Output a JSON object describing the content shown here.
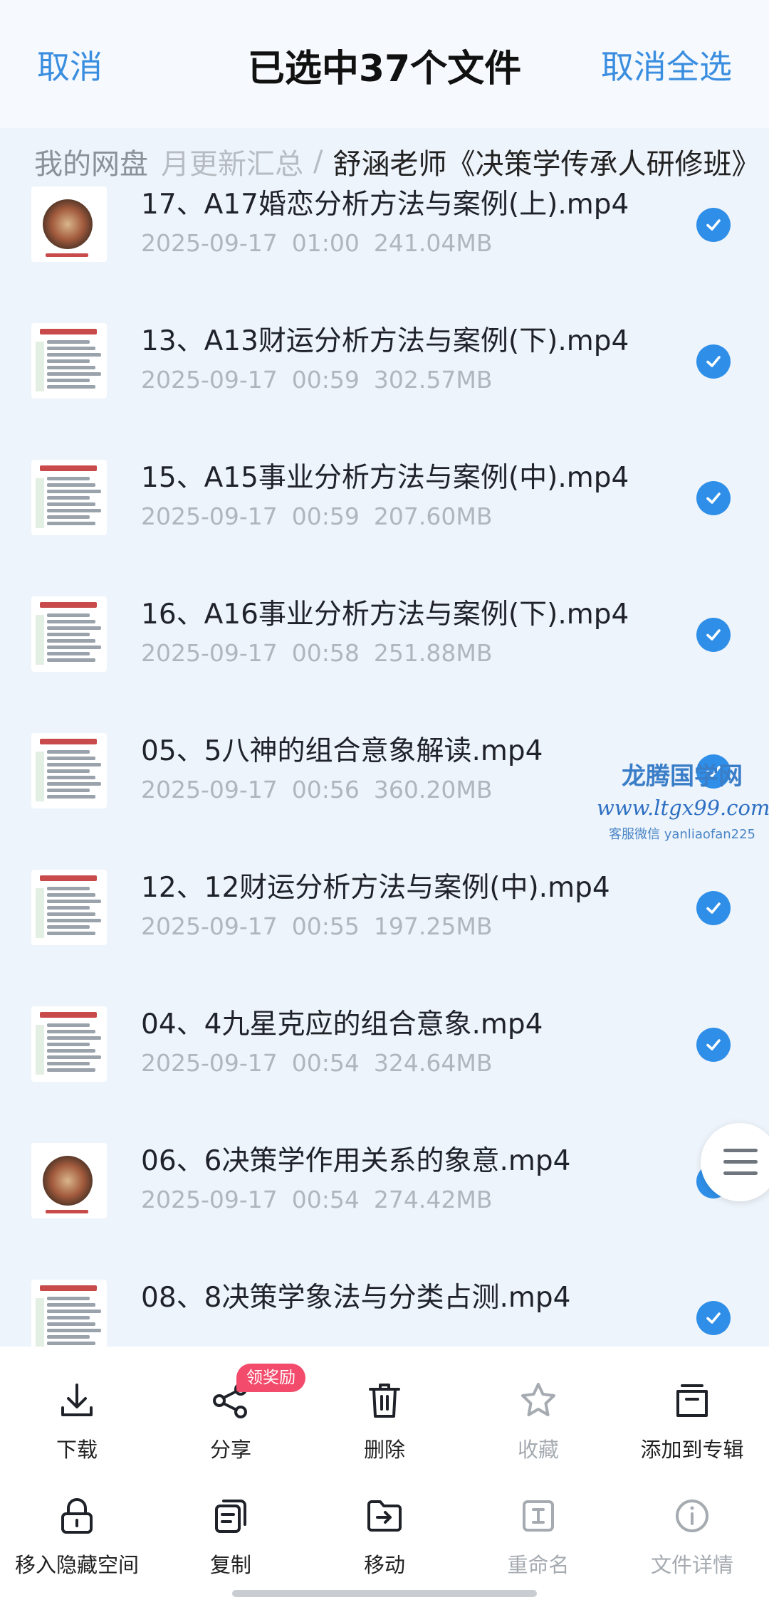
{
  "header": {
    "cancel": "取消",
    "title": "已选中37个文件",
    "deselect_all": "取消全选"
  },
  "breadcrumb": {
    "root": "我的网盘",
    "middle": "月更新汇总",
    "separator": "/",
    "current": "舒涵老师《决策学传承人研修班》"
  },
  "files": [
    {
      "name": "17、A17婚恋分析方法与案例(上).mp4",
      "date": "2025-09-17",
      "time": "01:00",
      "size": "241.04MB",
      "selected": true,
      "thumb": "chart"
    },
    {
      "name": "13、A13财运分析方法与案例(下).mp4",
      "date": "2025-09-17",
      "time": "00:59",
      "size": "302.57MB",
      "selected": true,
      "thumb": "doc"
    },
    {
      "name": "15、A15事业分析方法与案例(中).mp4",
      "date": "2025-09-17",
      "time": "00:59",
      "size": "207.60MB",
      "selected": true,
      "thumb": "doc"
    },
    {
      "name": "16、A16事业分析方法与案例(下).mp4",
      "date": "2025-09-17",
      "time": "00:58",
      "size": "251.88MB",
      "selected": true,
      "thumb": "doc"
    },
    {
      "name": "05、5八神的组合意象解读.mp4",
      "date": "2025-09-17",
      "time": "00:56",
      "size": "360.20MB",
      "selected": true,
      "thumb": "doc"
    },
    {
      "name": "12、12财运分析方法与案例(中).mp4",
      "date": "2025-09-17",
      "time": "00:55",
      "size": "197.25MB",
      "selected": true,
      "thumb": "doc"
    },
    {
      "name": "04、4九星克应的组合意象.mp4",
      "date": "2025-09-17",
      "time": "00:54",
      "size": "324.64MB",
      "selected": true,
      "thumb": "doc"
    },
    {
      "name": "06、6决策学作用关系的象意.mp4",
      "date": "2025-09-17",
      "time": "00:54",
      "size": "274.42MB",
      "selected": true,
      "thumb": "chart"
    },
    {
      "name": "08、8决策学象法与分类占测.mp4",
      "date": "",
      "time": "",
      "size": "",
      "selected": true,
      "thumb": "doc"
    }
  ],
  "watermark": {
    "title": "龙腾国学网",
    "url": "www.ltgx99.com",
    "contact": "客服微信 yanliaofan225"
  },
  "actions_row1": [
    {
      "label": "下载",
      "icon": "download-icon",
      "disabled": false
    },
    {
      "label": "分享",
      "icon": "share-icon",
      "disabled": false
    },
    {
      "label": "删除",
      "icon": "trash-icon",
      "disabled": false
    },
    {
      "label": "收藏",
      "icon": "star-icon",
      "disabled": true
    },
    {
      "label": "添加到专辑",
      "icon": "album-icon",
      "disabled": false
    }
  ],
  "actions_row2": [
    {
      "label": "移入隐藏空间",
      "icon": "lock-icon",
      "disabled": false
    },
    {
      "label": "复制",
      "icon": "copy-icon",
      "disabled": false
    },
    {
      "label": "移动",
      "icon": "move-icon",
      "disabled": false
    },
    {
      "label": "重命名",
      "icon": "rename-icon",
      "disabled": true
    },
    {
      "label": "文件详情",
      "icon": "info-icon",
      "disabled": true
    }
  ],
  "share_badge": "领奖励",
  "colors": {
    "accent": "#2f8fe8",
    "badge": "#f34b6c",
    "background": "#eef4fb"
  }
}
